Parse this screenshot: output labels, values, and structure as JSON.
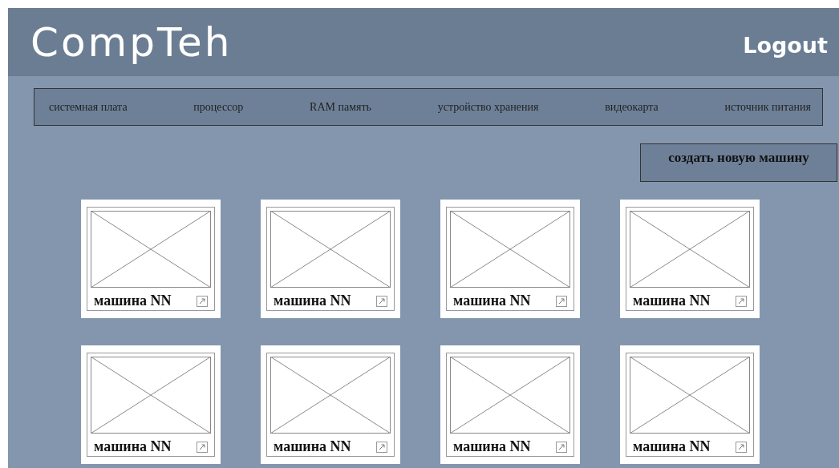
{
  "header": {
    "logo": "CompTeh",
    "logout": "Logout"
  },
  "nav": [
    "системная плата",
    "процессор",
    "RAM память",
    "устройство хранения",
    "видеокарта",
    "источник питания"
  ],
  "create_button": "создать новую машину",
  "cards": [
    {
      "title": "машина NN"
    },
    {
      "title": "машина NN"
    },
    {
      "title": "машина NN"
    },
    {
      "title": "машина NN"
    },
    {
      "title": "машина NN"
    },
    {
      "title": "машина NN"
    },
    {
      "title": "машина NN"
    },
    {
      "title": "машина NN"
    }
  ]
}
